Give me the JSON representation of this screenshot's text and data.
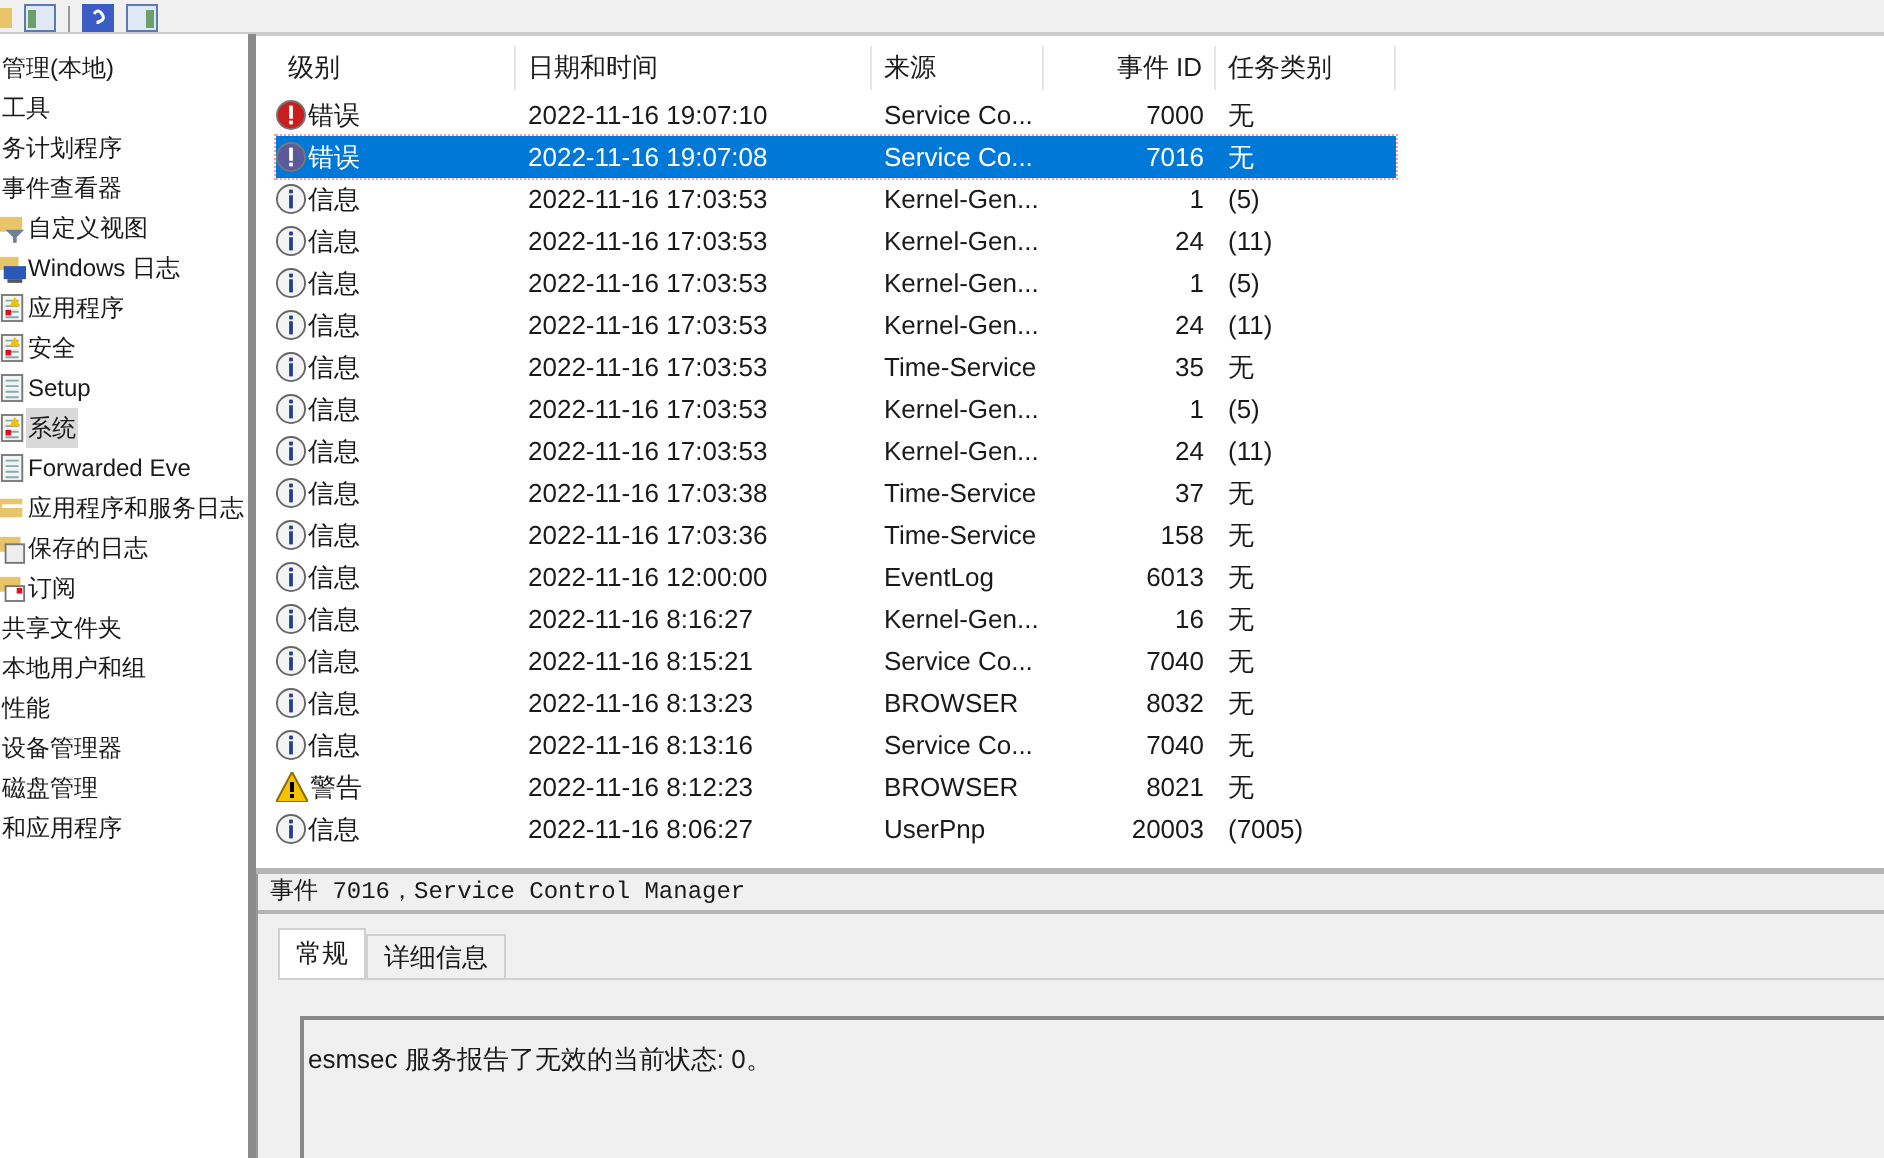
{
  "tree": [
    {
      "label": "管理(本地)",
      "selected": false
    },
    {
      "label": "工具",
      "selected": false,
      "children": [
        {
          "label": "务计划程序",
          "selected": false
        },
        {
          "label": "事件查看器",
          "selected": false,
          "children": [
            {
              "label": "自定义视图",
              "kind": "filter",
              "selected": false
            },
            {
              "label": "Windows 日志",
              "kind": "computer",
              "selected": false,
              "children": [
                {
                  "label": "应用程序",
                  "kind": "alertlog",
                  "selected": false
                },
                {
                  "label": "安全",
                  "kind": "alertlog",
                  "selected": false
                },
                {
                  "label": "Setup",
                  "kind": "log",
                  "selected": false
                },
                {
                  "label": "系统",
                  "kind": "alertlog",
                  "selected": true
                },
                {
                  "label": "Forwarded Eve",
                  "kind": "log",
                  "selected": false
                }
              ]
            },
            {
              "label": "应用程序和服务日志",
              "kind": "folder",
              "selected": false
            },
            {
              "label": "保存的日志",
              "kind": "saved",
              "selected": false
            },
            {
              "label": "订阅",
              "kind": "subscription",
              "selected": false
            }
          ]
        },
        {
          "label": "共享文件夹",
          "selected": false
        },
        {
          "label": "本地用户和组",
          "selected": false
        },
        {
          "label": "性能",
          "selected": false
        },
        {
          "label": "设备管理器",
          "selected": false
        }
      ]
    },
    {
      "label": "磁盘管理",
      "selected": false
    },
    {
      "label": "和应用程序",
      "selected": false
    }
  ],
  "table": {
    "columns": [
      "级别",
      "日期和时间",
      "来源",
      "事件 ID",
      "任务类别"
    ],
    "rows": [
      {
        "kind": "error",
        "level": "错误",
        "time": "2022-11-16 19:07:10",
        "source": "Service Co...",
        "id": "7000",
        "task": "无",
        "selected": false
      },
      {
        "kind": "error",
        "level": "错误",
        "time": "2022-11-16 19:07:08",
        "source": "Service Co...",
        "id": "7016",
        "task": "无",
        "selected": true
      },
      {
        "kind": "info",
        "level": "信息",
        "time": "2022-11-16 17:03:53",
        "source": "Kernel-Gen...",
        "id": "1",
        "task": "(5)",
        "selected": false
      },
      {
        "kind": "info",
        "level": "信息",
        "time": "2022-11-16 17:03:53",
        "source": "Kernel-Gen...",
        "id": "24",
        "task": "(11)",
        "selected": false
      },
      {
        "kind": "info",
        "level": "信息",
        "time": "2022-11-16 17:03:53",
        "source": "Kernel-Gen...",
        "id": "1",
        "task": "(5)",
        "selected": false
      },
      {
        "kind": "info",
        "level": "信息",
        "time": "2022-11-16 17:03:53",
        "source": "Kernel-Gen...",
        "id": "24",
        "task": "(11)",
        "selected": false
      },
      {
        "kind": "info",
        "level": "信息",
        "time": "2022-11-16 17:03:53",
        "source": "Time-Service",
        "id": "35",
        "task": "无",
        "selected": false
      },
      {
        "kind": "info",
        "level": "信息",
        "time": "2022-11-16 17:03:53",
        "source": "Kernel-Gen...",
        "id": "1",
        "task": "(5)",
        "selected": false
      },
      {
        "kind": "info",
        "level": "信息",
        "time": "2022-11-16 17:03:53",
        "source": "Kernel-Gen...",
        "id": "24",
        "task": "(11)",
        "selected": false
      },
      {
        "kind": "info",
        "level": "信息",
        "time": "2022-11-16 17:03:38",
        "source": "Time-Service",
        "id": "37",
        "task": "无",
        "selected": false
      },
      {
        "kind": "info",
        "level": "信息",
        "time": "2022-11-16 17:03:36",
        "source": "Time-Service",
        "id": "158",
        "task": "无",
        "selected": false
      },
      {
        "kind": "info",
        "level": "信息",
        "time": "2022-11-16 12:00:00",
        "source": "EventLog",
        "id": "6013",
        "task": "无",
        "selected": false
      },
      {
        "kind": "info",
        "level": "信息",
        "time": "2022-11-16 8:16:27",
        "source": "Kernel-Gen...",
        "id": "16",
        "task": "无",
        "selected": false
      },
      {
        "kind": "info",
        "level": "信息",
        "time": "2022-11-16 8:15:21",
        "source": "Service Co...",
        "id": "7040",
        "task": "无",
        "selected": false
      },
      {
        "kind": "info",
        "level": "信息",
        "time": "2022-11-16 8:13:23",
        "source": "BROWSER",
        "id": "8032",
        "task": "无",
        "selected": false
      },
      {
        "kind": "info",
        "level": "信息",
        "time": "2022-11-16 8:13:16",
        "source": "Service Co...",
        "id": "7040",
        "task": "无",
        "selected": false
      },
      {
        "kind": "warning",
        "level": "警告",
        "time": "2022-11-16 8:12:23",
        "source": "BROWSER",
        "id": "8021",
        "task": "无",
        "selected": false
      },
      {
        "kind": "info",
        "level": "信息",
        "time": "2022-11-16 8:06:27",
        "source": "UserPnp",
        "id": "20003",
        "task": "(7005)",
        "selected": false
      }
    ]
  },
  "detail": {
    "title": "事件 7016，Service Control Manager",
    "tabs": [
      {
        "label": "常规",
        "selected": true
      },
      {
        "label": "详细信息",
        "selected": false
      }
    ],
    "message": "esmsec 服务报告了无效的当前状态: 0。"
  }
}
